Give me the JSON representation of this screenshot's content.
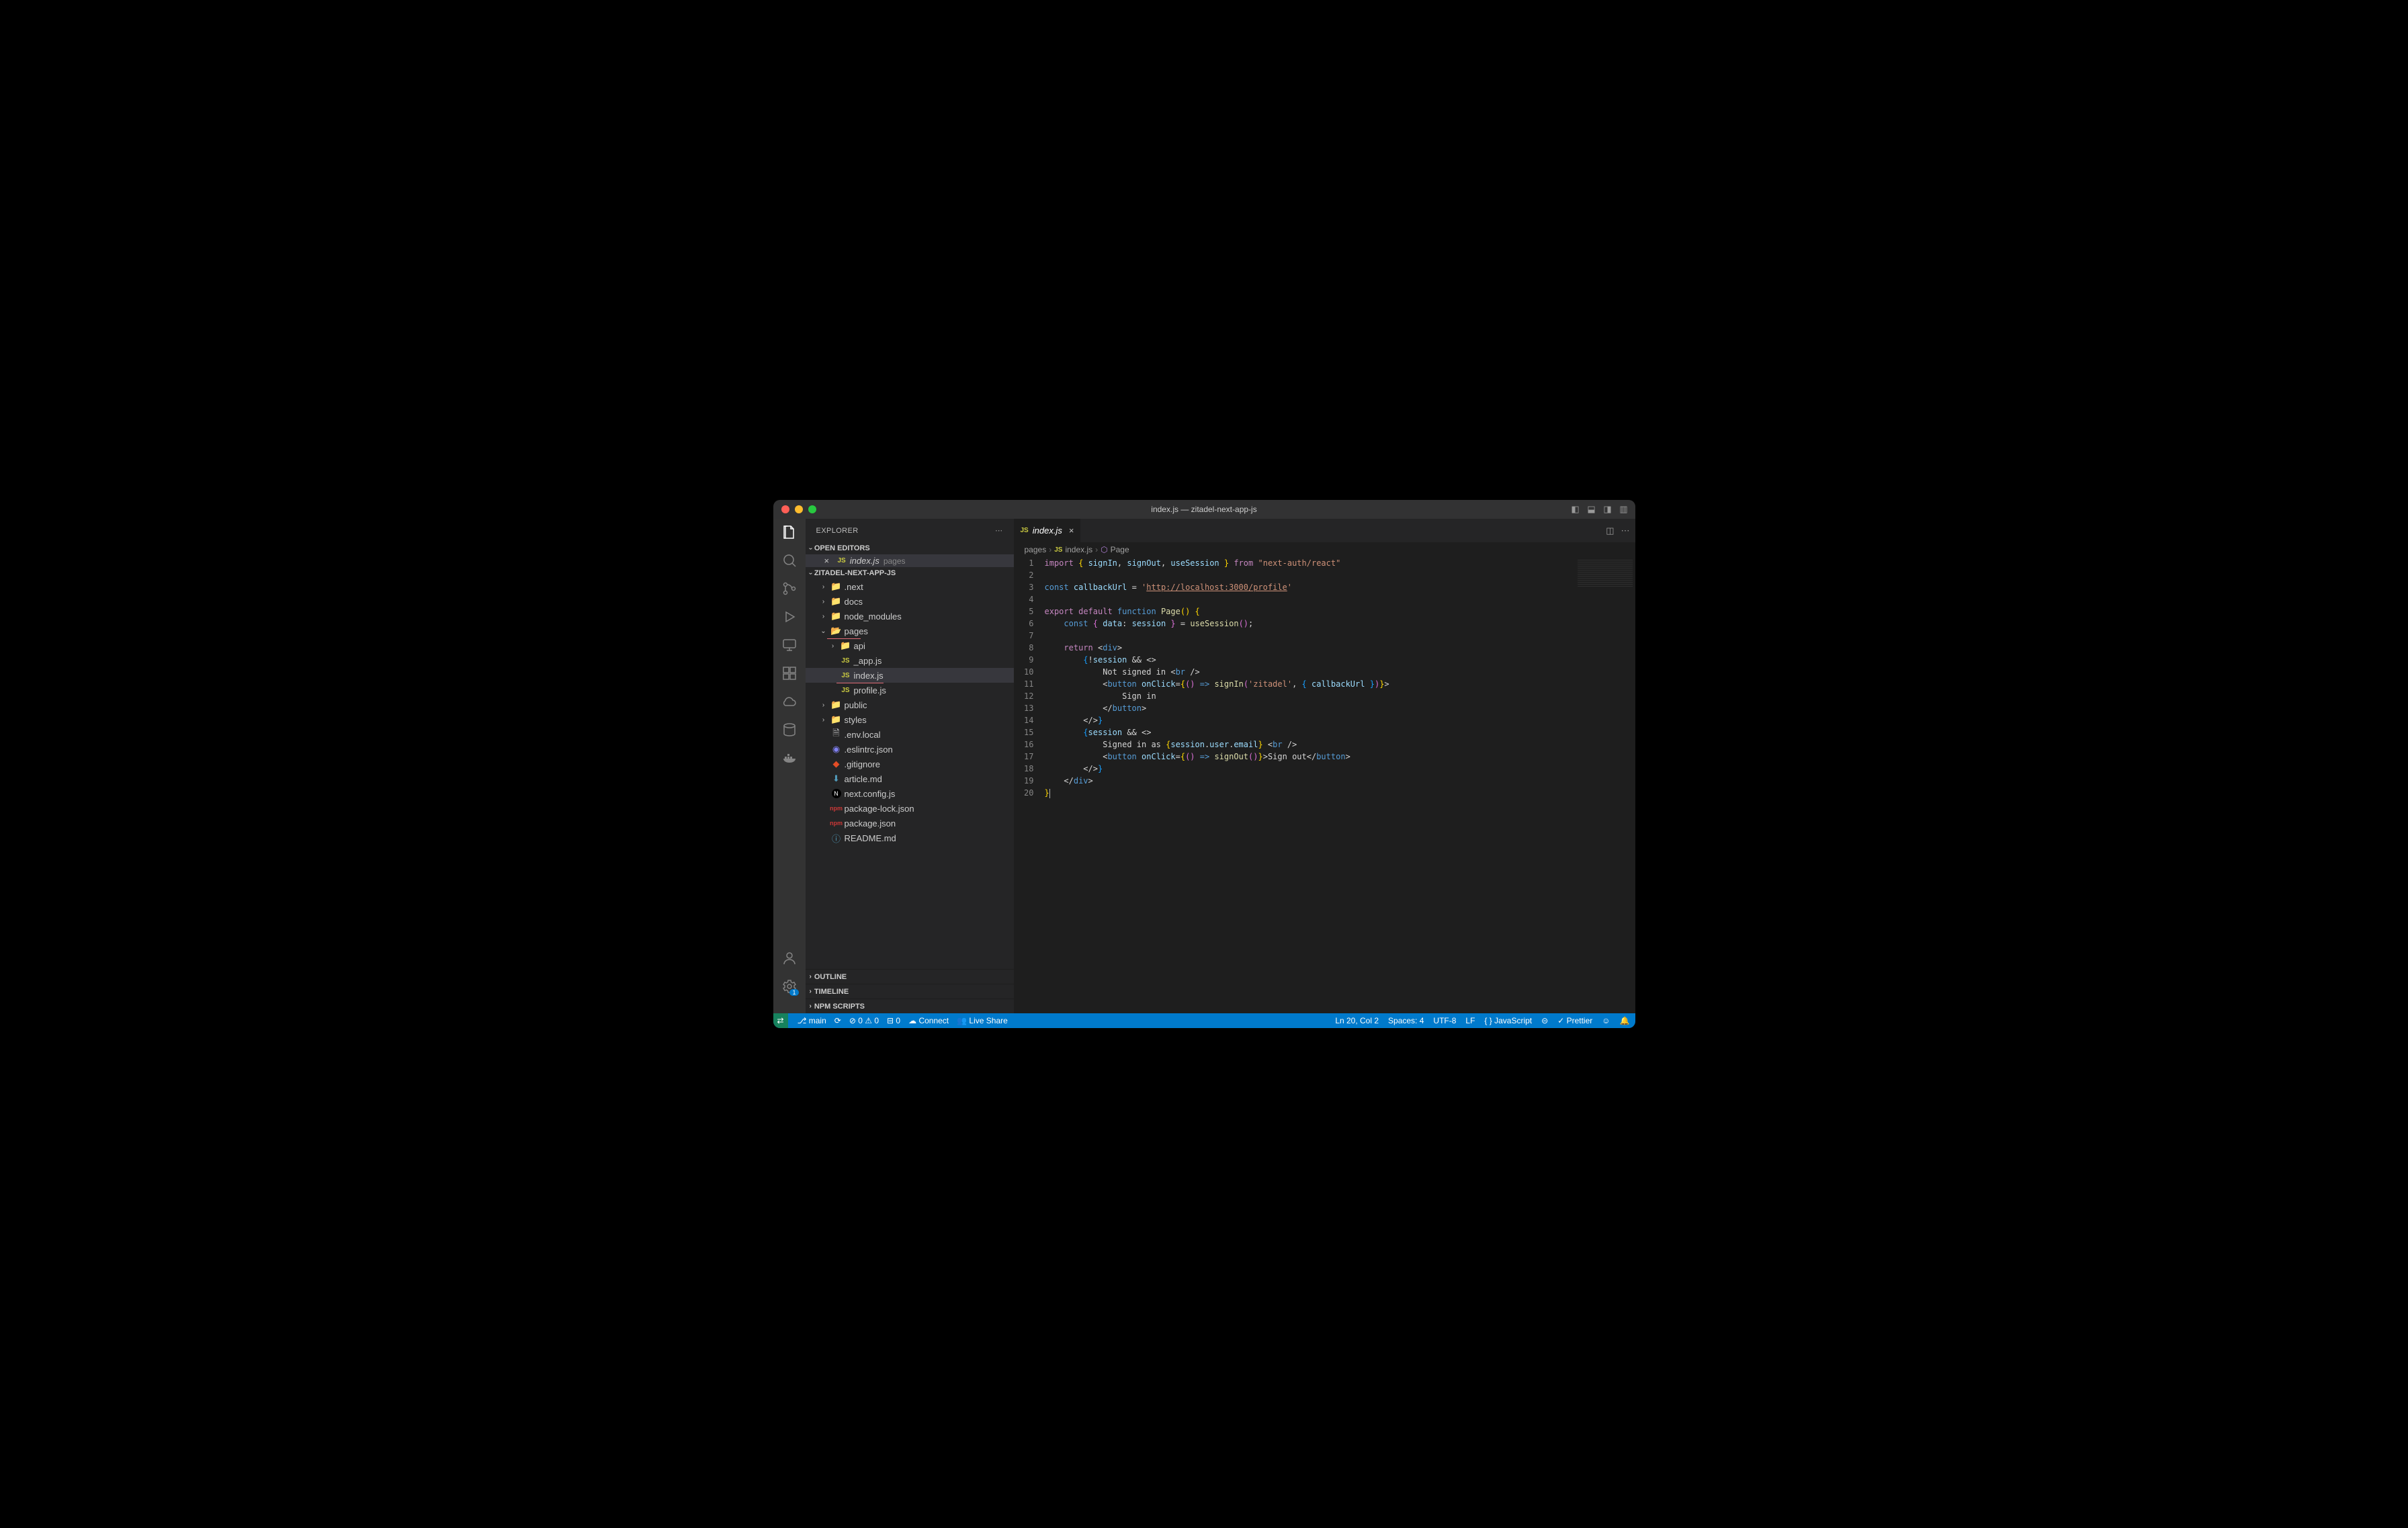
{
  "window": {
    "title": "index.js — zitadel-next-app-js"
  },
  "sidebar": {
    "title": "EXPLORER",
    "openEditors": "OPEN EDITORS",
    "project": "ZITADEL-NEXT-APP-JS",
    "sections": {
      "outline": "OUTLINE",
      "timeline": "TIMELINE",
      "npm": "NPM SCRIPTS"
    }
  },
  "openTab": {
    "name": "index.js",
    "path": "pages"
  },
  "tree": [
    {
      "label": ".next",
      "icon": "folder",
      "depth": 1,
      "twist": ">"
    },
    {
      "label": "docs",
      "icon": "folder",
      "depth": 1,
      "twist": ">"
    },
    {
      "label": "node_modules",
      "icon": "folder-dim",
      "depth": 1,
      "twist": ">"
    },
    {
      "label": "pages",
      "icon": "folder-open",
      "depth": 1,
      "twist": "v",
      "underline": true,
      "ulwidth": 50,
      "uleft": 32
    },
    {
      "label": "api",
      "icon": "folder",
      "depth": 2,
      "twist": ">"
    },
    {
      "label": "_app.js",
      "icon": "js",
      "depth": 2
    },
    {
      "label": "index.js",
      "icon": "js",
      "depth": 2,
      "sel": true,
      "underline": true,
      "ulwidth": 70,
      "uleft": 46
    },
    {
      "label": "profile.js",
      "icon": "js",
      "depth": 2
    },
    {
      "label": "public",
      "icon": "folder",
      "depth": 1,
      "twist": ">"
    },
    {
      "label": "styles",
      "icon": "folder",
      "depth": 1,
      "twist": ">"
    },
    {
      "label": ".env.local",
      "icon": "file",
      "depth": 1
    },
    {
      "label": ".eslintrc.json",
      "icon": "eslint",
      "depth": 1
    },
    {
      "label": ".gitignore",
      "icon": "git",
      "depth": 1
    },
    {
      "label": "article.md",
      "icon": "md",
      "depth": 1
    },
    {
      "label": "next.config.js",
      "icon": "next",
      "depth": 1
    },
    {
      "label": "package-lock.json",
      "icon": "npm",
      "depth": 1
    },
    {
      "label": "package.json",
      "icon": "npm",
      "depth": 1
    },
    {
      "label": "README.md",
      "icon": "info",
      "depth": 1
    }
  ],
  "tab": {
    "name": "index.js"
  },
  "breadcrumb": {
    "p0": "pages",
    "p1": "index.js",
    "p2": "Page"
  },
  "code": {
    "lines": 20,
    "l1": "import { signIn, signOut, useSession } from \"next-auth/react\"",
    "l3": "const callbackUrl = 'http://localhost:3000/profile'",
    "l5": "export default function Page() {",
    "l6": "    const { data: session } = useSession();",
    "l8": "    return <div>",
    "l9": "        {!session && <>",
    "l10": "            Not signed in <br />",
    "l11": "            <button onClick={() => signIn('zitadel', { callbackUrl })}>",
    "l12": "                Sign in",
    "l13": "            </button>",
    "l14": "        </>}",
    "l15": "        {session && <>",
    "l16": "            Signed in as {session.user.email} <br />",
    "l17": "            <button onClick={() => signOut()}>Sign out</button>",
    "l18": "        </>}",
    "l19": "    </div>",
    "l20": "}"
  },
  "status": {
    "branch": "main",
    "errors": "0",
    "warnings": "0",
    "ports": "0",
    "connect": "Connect",
    "liveshare": "Live Share",
    "cursor": "Ln 20, Col 2",
    "spaces": "Spaces: 4",
    "encoding": "UTF-8",
    "eol": "LF",
    "lang": "JavaScript",
    "prettier": "Prettier"
  }
}
